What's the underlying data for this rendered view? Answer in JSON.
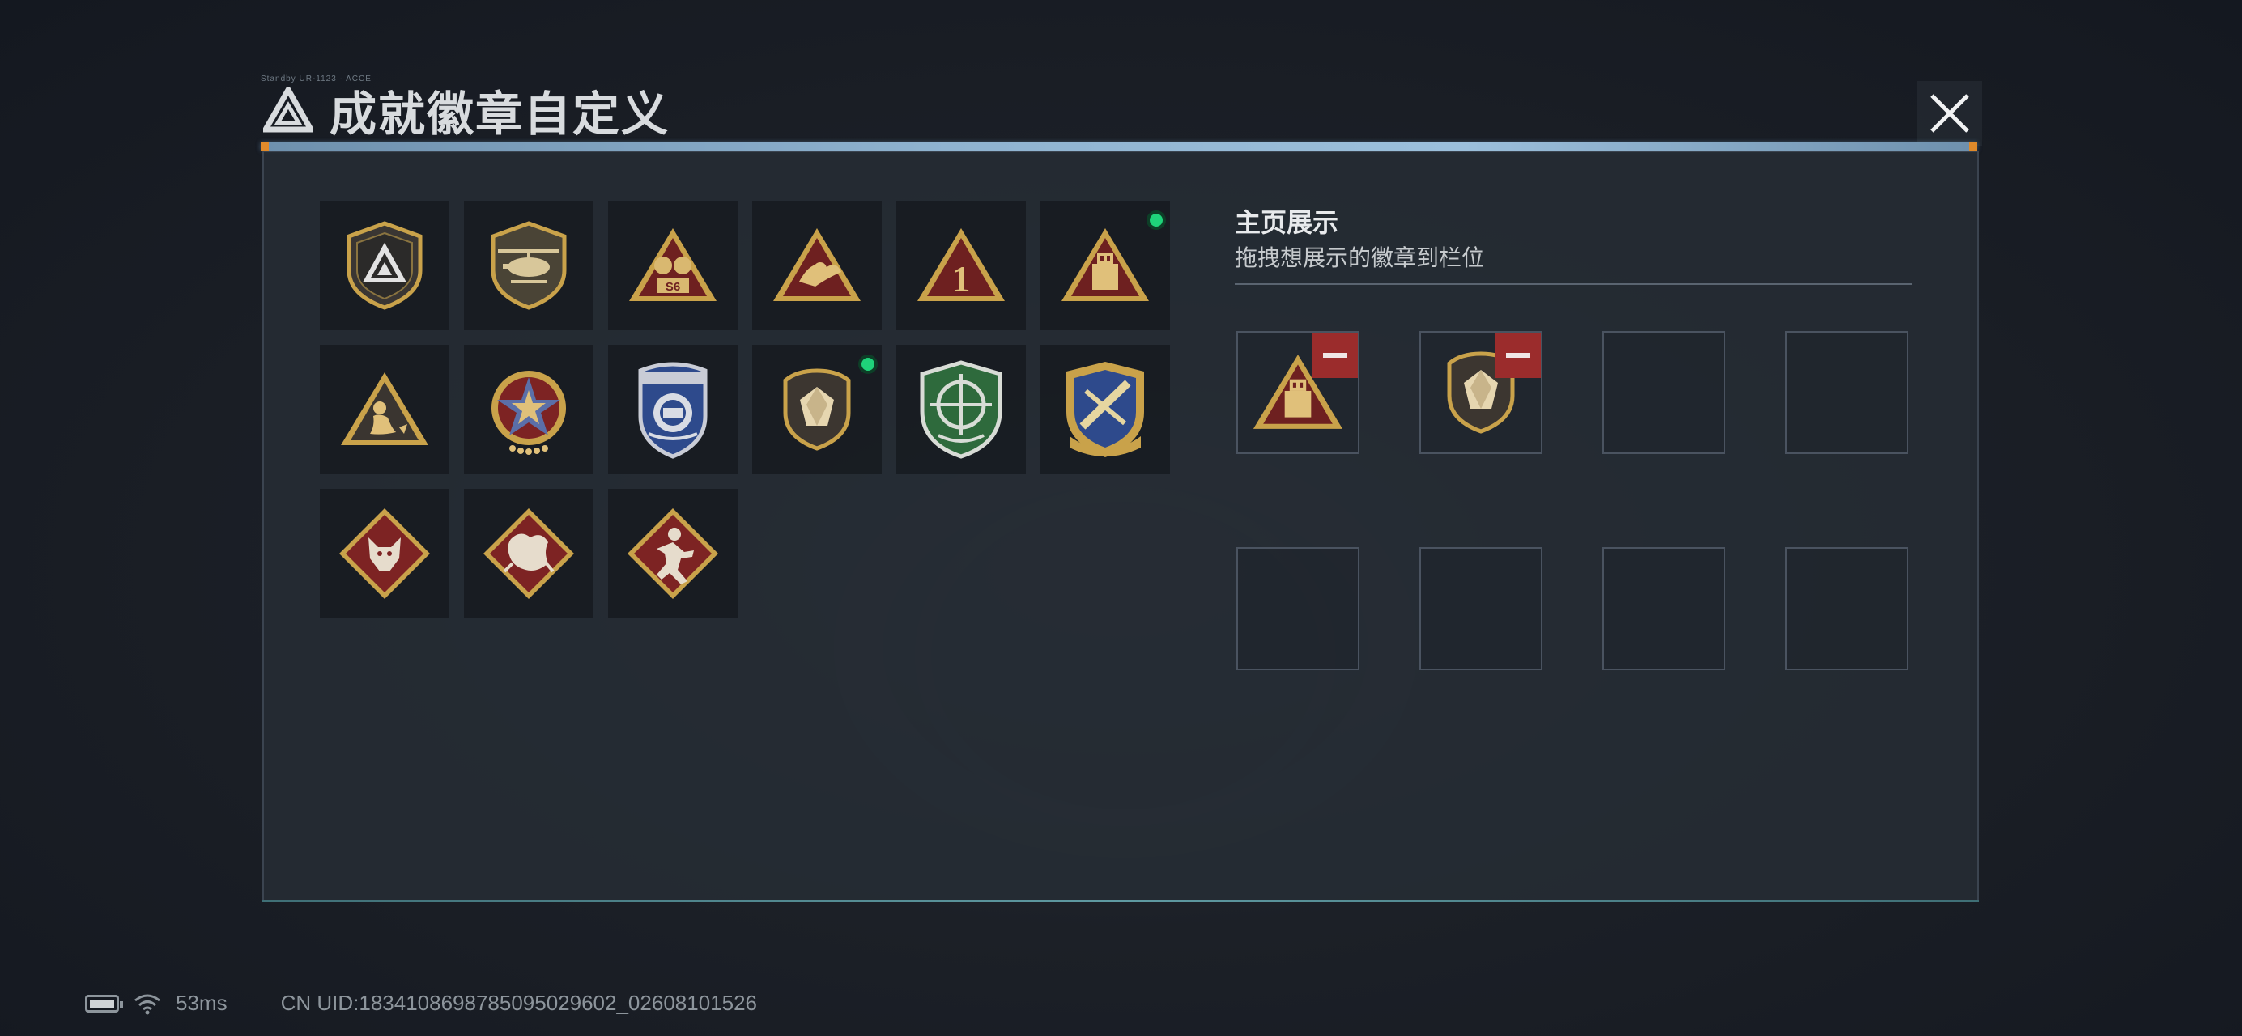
{
  "header": {
    "title": "成就徽章自定义",
    "tiny_caption": "Standby UR-1123 · ACCE"
  },
  "badges": [
    {
      "name": "delta-shield-badge",
      "new": false
    },
    {
      "name": "helicopter-shield-badge",
      "new": false
    },
    {
      "name": "s6-triangle-badge",
      "new": false
    },
    {
      "name": "bird-triangle-badge",
      "new": false
    },
    {
      "name": "number-one-triangle-badge",
      "new": false
    },
    {
      "name": "usb-drive-triangle-badge",
      "new": true
    },
    {
      "name": "mermaid-triangle-badge",
      "new": false
    },
    {
      "name": "star-medal-badge",
      "new": false
    },
    {
      "name": "blue-police-badge",
      "new": false
    },
    {
      "name": "crystal-shield-badge",
      "new": true
    },
    {
      "name": "green-crosshair-badge",
      "new": false
    },
    {
      "name": "blue-gold-aviation-badge",
      "new": false
    },
    {
      "name": "wolf-diamond-badge",
      "new": false
    },
    {
      "name": "dragon-diamond-badge",
      "new": false
    },
    {
      "name": "runner-diamond-badge",
      "new": false
    }
  ],
  "homepage_display": {
    "title": "主页展示",
    "subtitle": "拖拽想展示的徽章到栏位",
    "slots": [
      {
        "badge": "usb-drive-triangle-badge",
        "removable": true
      },
      {
        "badge": "crystal-shield-badge",
        "removable": true
      },
      {
        "badge": null,
        "removable": false
      },
      {
        "badge": null,
        "removable": false
      },
      {
        "badge": null,
        "removable": false
      },
      {
        "badge": null,
        "removable": false
      },
      {
        "badge": null,
        "removable": false
      },
      {
        "badge": null,
        "removable": false
      }
    ]
  },
  "status_bar": {
    "battery_icon": "battery-charging-icon",
    "wifi_icon": "wifi-icon",
    "ping": "53ms",
    "uid": "CN UID:1834108698785095029602_02608101526"
  },
  "colors": {
    "accent_blue": "#8fb3d0",
    "new_dot_green": "#1fd27a",
    "remove_red": "#9b2c2c",
    "badge_red": "#7d2323",
    "badge_gold": "#c9a24a"
  }
}
